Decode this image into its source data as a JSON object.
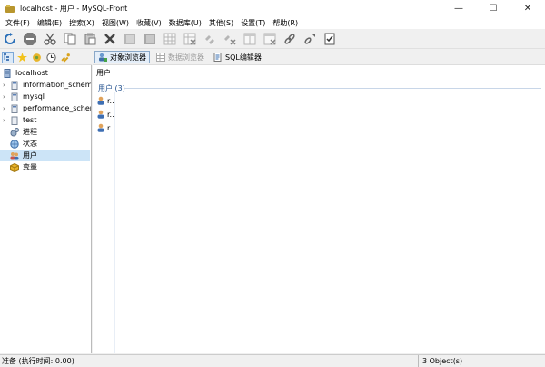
{
  "window": {
    "title": "localhost - 用户 - MySQL-Front",
    "minimize": "—",
    "maximize": "☐",
    "close": "✕"
  },
  "menu": [
    {
      "label": "文件(F)"
    },
    {
      "label": "编辑(E)"
    },
    {
      "label": "搜索(X)"
    },
    {
      "label": "视图(W)"
    },
    {
      "label": "收藏(V)"
    },
    {
      "label": "数据库(U)"
    },
    {
      "label": "其他(S)"
    },
    {
      "label": "设置(T)"
    },
    {
      "label": "帮助(R)"
    }
  ],
  "toolbar": {
    "icons": [
      "refresh-icon",
      "stop-icon",
      "cut-icon",
      "copy-icon",
      "paste-icon",
      "delete-icon",
      "import-icon",
      "export-icon",
      "grid-icon",
      "grid-delete-icon",
      "link-icon",
      "link-delete-icon",
      "table-icon",
      "table-delete-icon",
      "chain-icon",
      "chain-arrow-icon",
      "checklist-icon"
    ]
  },
  "left_tabs": {
    "icons": [
      "tree-icon",
      "star-icon",
      "folder-icon",
      "clock-icon",
      "key-icon"
    ]
  },
  "view_tabs": [
    {
      "label": "对象浏览器",
      "state": "active"
    },
    {
      "label": "数据浏览器",
      "state": "disabled"
    },
    {
      "label": "SQL编辑器",
      "state": "normal"
    }
  ],
  "tree": {
    "root": "localhost",
    "databases": [
      "information_schem",
      "mysql",
      "performance_scher",
      "test"
    ],
    "items": [
      "进程",
      "状态",
      "用户",
      "变量"
    ]
  },
  "content": {
    "header": "用户",
    "group_label": "用户 (3)",
    "users": [
      "r..",
      "r..",
      "r.."
    ]
  },
  "status": {
    "left": "准备  (执行时间: 0.00)",
    "right": "3 Object(s)"
  },
  "colors": {
    "accent": "#1f4e8c",
    "selection": "#cce4f7"
  }
}
